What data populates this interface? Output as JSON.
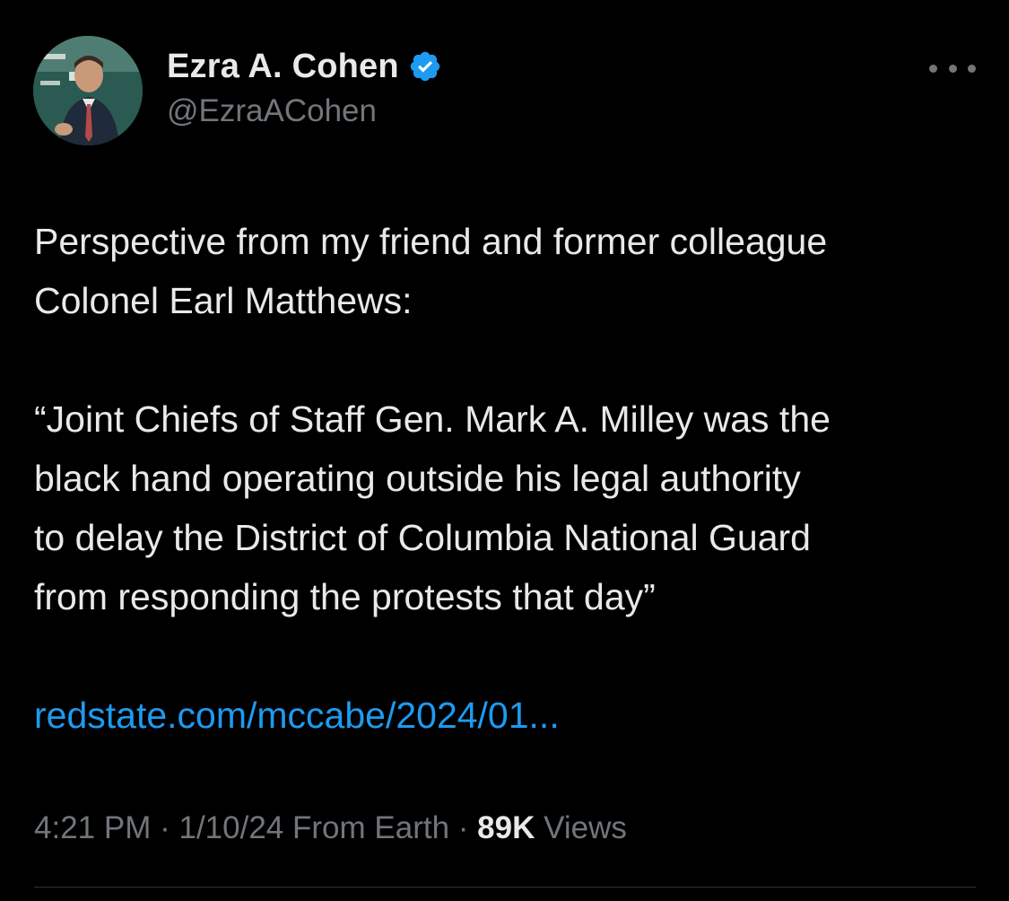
{
  "author": {
    "display_name": "Ezra A. Cohen",
    "handle": "@EzraACohen",
    "verified": true,
    "avatar_icon": "profile-photo"
  },
  "menu": {
    "icon": "more-options-icon"
  },
  "tweet": {
    "line1": "Perspective from my friend and former colleague",
    "line2": "Colonel Earl Matthews:",
    "quote_lines": [
      "“Joint Chiefs of Staff Gen. Mark A. Milley was the",
      "black hand operating outside his legal authority",
      "to delay the District of Columbia National Guard",
      "from responding the protests that day”"
    ],
    "link": "redstate.com/mccabe/2024/01..."
  },
  "meta": {
    "time": "4:21 PM",
    "separator": "·",
    "date": "1/10/24",
    "source": "From Earth",
    "views_count": "89K",
    "views_label": "Views"
  },
  "colors": {
    "background": "#000000",
    "text": "#e7e9ea",
    "secondary": "#71767b",
    "link": "#1d9bf0",
    "verified": "#1d9bf0"
  }
}
